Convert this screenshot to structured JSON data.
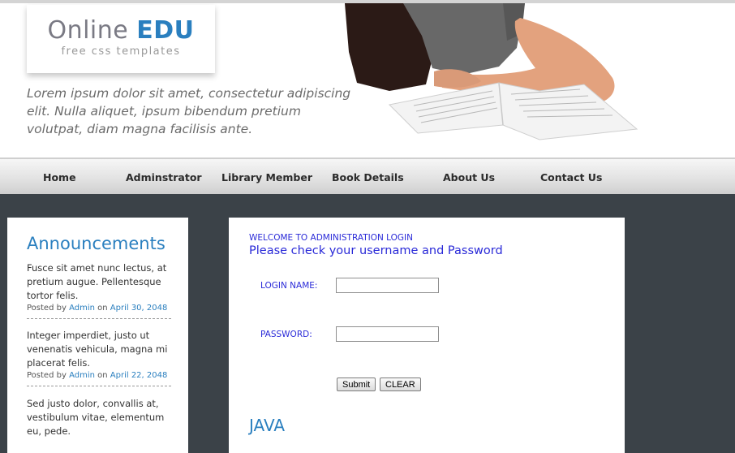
{
  "header": {
    "logo": {
      "title_main": "Online",
      "title_accent": "EDU",
      "subtitle": "free css templates"
    },
    "tagline": "Lorem ipsum dolor sit amet, consectetur adipiscing elit. Nulla aliquet, ipsum bibendum pretium volutpat, diam magna facilisis ante."
  },
  "nav": {
    "items": [
      {
        "label": "Home"
      },
      {
        "label": "Adminstrator"
      },
      {
        "label": "Library Member"
      },
      {
        "label": "Book Details"
      },
      {
        "label": "About Us"
      },
      {
        "label": "Contact Us"
      }
    ]
  },
  "sidebar": {
    "title": "Announcements",
    "items": [
      {
        "text": "Fusce sit amet nunc lectus, at pretium augue. Pellentesque tortor felis.",
        "posted_by": "Posted by",
        "author": "Admin",
        "on": "on",
        "date": "April 30, 2048"
      },
      {
        "text": "Integer imperdiet, justo ut venenatis vehicula, magna mi placerat felis.",
        "posted_by": "Posted by",
        "author": "Admin",
        "on": "on",
        "date": "April 22, 2048"
      },
      {
        "text": "Sed justo dolor, convallis at, vestibulum vitae, elementum eu, pede."
      }
    ]
  },
  "main": {
    "welcome": "WELCOME TO ADMINISTRATION LOGIN",
    "instruction": "Please check your username and Password",
    "login_label": "LOGIN NAME:",
    "login_value": "",
    "password_label": "PASSWORD:",
    "password_value": "",
    "submit_label": "Submit",
    "clear_label": "CLEAR",
    "section_heading": "JAVA"
  },
  "colors": {
    "accent": "#2a7fbf",
    "form_text": "#2a2ad8",
    "page_bg": "#3b4248"
  }
}
